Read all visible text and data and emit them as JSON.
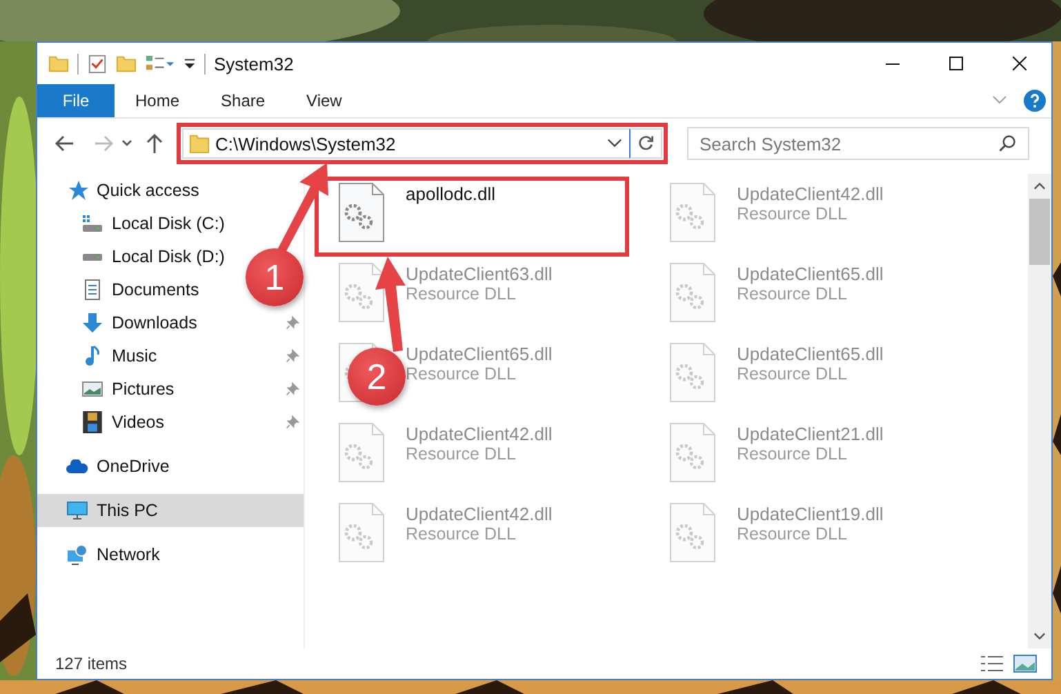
{
  "window": {
    "title": "System32"
  },
  "ribbon_tabs": [
    {
      "label": "File",
      "kind": "file"
    },
    {
      "label": "Home",
      "kind": "tab"
    },
    {
      "label": "Share",
      "kind": "tab"
    },
    {
      "label": "View",
      "kind": "tab"
    }
  ],
  "address": {
    "path": "C:\\Windows\\System32",
    "highlighted": true
  },
  "search": {
    "placeholder": "Search System32"
  },
  "nav": [
    {
      "label": "Quick access",
      "selected": false,
      "children": [
        {
          "label": "Local Disk (C:)",
          "pinned": false,
          "selected": false
        },
        {
          "label": "Local Disk (D:)",
          "pinned": false,
          "selected": false
        },
        {
          "label": "Documents",
          "pinned": false,
          "selected": false
        },
        {
          "label": "Downloads",
          "pinned": true,
          "selected": false
        },
        {
          "label": "Music",
          "pinned": true,
          "selected": false
        },
        {
          "label": "Pictures",
          "pinned": true,
          "selected": false
        },
        {
          "label": "Videos",
          "pinned": true,
          "selected": false
        }
      ]
    },
    {
      "label": "OneDrive",
      "selected": false
    },
    {
      "label": "This PC",
      "selected": true
    },
    {
      "label": "Network",
      "selected": false
    }
  ],
  "files": [
    {
      "name": "apollodc.dll",
      "dimmed": false,
      "highlighted": true
    },
    {
      "name": "UpdateClient42.dll",
      "type": "Resource DLL",
      "dimmed": true,
      "highlighted": false
    },
    {
      "name": "UpdateClient63.dll",
      "type": "Resource DLL",
      "dimmed": true,
      "highlighted": false
    },
    {
      "name": "UpdateClient65.dll",
      "type": "Resource DLL",
      "dimmed": true,
      "highlighted": false
    },
    {
      "name": "UpdateClient65.dll",
      "type": "Resource DLL",
      "dimmed": true,
      "highlighted": false
    },
    {
      "name": "UpdateClient65.dll",
      "type": "Resource DLL",
      "dimmed": true,
      "highlighted": false
    },
    {
      "name": "UpdateClient42.dll",
      "type": "Resource DLL",
      "dimmed": true,
      "highlighted": false
    },
    {
      "name": "UpdateClient21.dll",
      "type": "Resource DLL",
      "dimmed": true,
      "highlighted": false
    },
    {
      "name": "UpdateClient42.dll",
      "type": "Resource DLL",
      "dimmed": true,
      "highlighted": false
    },
    {
      "name": "UpdateClient19.dll",
      "type": "Resource DLL",
      "dimmed": true,
      "highlighted": false
    }
  ],
  "status_bar": {
    "item_count": "127 items"
  },
  "steps": [
    {
      "label": "1"
    },
    {
      "label": "2"
    }
  ]
}
